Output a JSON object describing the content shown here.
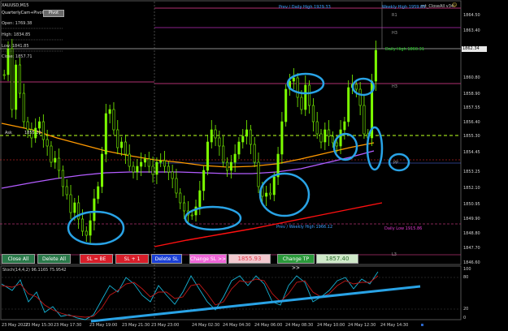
{
  "window": {
    "symbol_title": "XAUUSD,M15",
    "indicator_name": "QuarterlyCam+Pivot",
    "pivot_button": "Pivot",
    "expert_name": "mt_CloseAll v34",
    "expert_face": "☺"
  },
  "info_panel": {
    "open": "Open: 1769.38",
    "high": "High: 1834.85",
    "low": "Low: 1841.85",
    "close": "Close: 1857.71"
  },
  "levels": {
    "prev_daily_high": "Prev / Daily High 1929.33",
    "weekly_high": "Weekly High 1959.05",
    "daily_high": "Daily High 1860.31",
    "prev_weekly_high": "Prev / Weekly High 1966.12",
    "daily_low": "Daily Low 1915.86",
    "r1": "R1",
    "h3_top": "H3",
    "h3_mid": "H3",
    "pp": "PP",
    "l3": "L3",
    "current_price_label": "1855.20",
    "ask_label": "Ask"
  },
  "price_axis": [
    "1864.50",
    "1863.40",
    "1862.34",
    "1860.80",
    "1858.90",
    "1857.55",
    "1856.40",
    "1855.30",
    "1854.45",
    "1853.25",
    "1852.10",
    "1850.95",
    "1849.90",
    "1848.80",
    "1847.70",
    "1846.60"
  ],
  "current_price_tag": "1862.34",
  "buttons": {
    "close_all": "Close All",
    "delete_all": "Delete All",
    "sl_be": "SL = BE",
    "sl_plus": "SL + 1",
    "delete_sl": "Delete SL",
    "change_sl": "Change SL >>",
    "sl_value": "1855.93",
    "change_tp": "Change TP >>",
    "tp_value": "1857.40"
  },
  "stochastic": {
    "label": "Stoch(14,4,2) 96.1165 75.9542",
    "levels": [
      "100",
      "80",
      "20",
      "0"
    ]
  },
  "time_axis": [
    "23 May 2022",
    "23 May 15:30",
    "23 May 17:30",
    "23 May 19:00",
    "23 May 21:30",
    "23 May 23:00",
    "24 May 02:30",
    "24 May 04:30",
    "24 May 06:00",
    "24 May 08:30",
    "24 May 10:00",
    "24 May 12:30",
    "24 May 14:30"
  ],
  "colors": {
    "background": "#000000",
    "bull_candle": "#7cfc00",
    "ma_orange": "#ff9900",
    "ma_purple": "#b35cff",
    "ma_red": "#ff1010",
    "annotation_blue": "#29a3e6",
    "level_line": "#b03070"
  }
}
